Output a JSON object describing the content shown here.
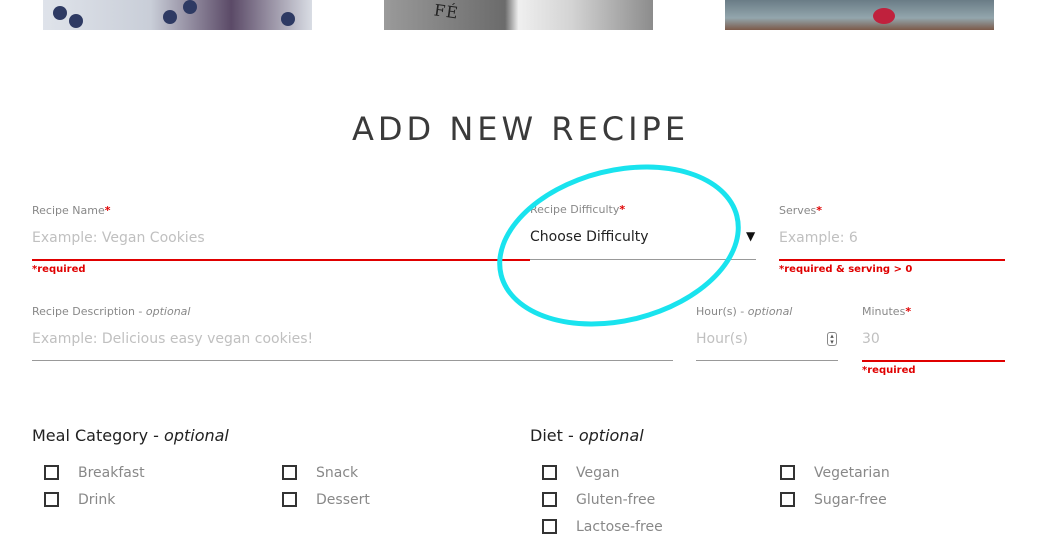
{
  "page": {
    "title": "ADD NEW RECIPE"
  },
  "form": {
    "recipe_name": {
      "label": "Recipe Name",
      "required_mark": "*",
      "placeholder": "Example: Vegan Cookies",
      "error": "*required"
    },
    "recipe_difficulty": {
      "label": "Recipe Difficulty",
      "required_mark": "*",
      "selected": "Choose Difficulty",
      "arrow": "▼"
    },
    "serves": {
      "label": "Serves",
      "required_mark": "*",
      "placeholder": "Example: 6",
      "error": "*required & serving > 0"
    },
    "recipe_description": {
      "label": "Recipe Description",
      "label_suffix": " - ",
      "optional": "optional",
      "placeholder": "Example: Delicious easy vegan cookies!"
    },
    "hours": {
      "label": "Hour(s)",
      "label_suffix": " - ",
      "optional": "optional",
      "placeholder": "Hour(s)"
    },
    "minutes": {
      "label": "Minutes",
      "required_mark": "*",
      "placeholder": "30",
      "error": "*required"
    }
  },
  "meal_category": {
    "title": "Meal Category",
    "suffix": " - ",
    "optional": "optional",
    "options": [
      "Breakfast",
      "Snack",
      "Drink",
      "Dessert"
    ]
  },
  "diet": {
    "title": "Diet",
    "suffix": " - ",
    "optional": "optional",
    "options": [
      "Vegan",
      "Vegetarian",
      "Gluten-free",
      "Sugar-free",
      "Lactose-free"
    ]
  },
  "thumbnails": {
    "t2_text": "FÉ"
  },
  "colors": {
    "accent_red": "#e00000",
    "highlight_ring": "#19e3ee"
  }
}
